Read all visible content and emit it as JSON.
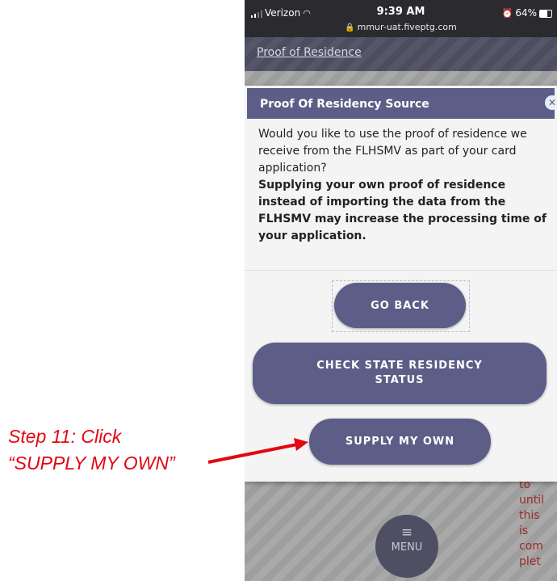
{
  "status_bar": {
    "carrier": "Verizon",
    "time": "9:39 AM",
    "battery": "64%",
    "url": "mmur-uat.fiveptg.com"
  },
  "page": {
    "title": "Proof of Residence"
  },
  "dialog": {
    "title": "Proof Of Residency Source",
    "question": "Would you like to use the proof of residence we receive from the FLHSMV as part of your card application?",
    "warning": "Supplying your own proof of residence instead of importing the data from the FLHSMV may increase the processing time of your application.",
    "buttons": {
      "go_back": "GO BACK",
      "check_state_line1": "CHECK STATE RESIDENCY",
      "check_state_line2": "STATUS",
      "supply_own": "SUPPLY MY OWN"
    }
  },
  "background_text": [
    "to",
    "until",
    "this",
    "is",
    "com",
    "plet"
  ],
  "menu": {
    "label": "MENU"
  },
  "annotation": {
    "line1": "Step 11: Click",
    "line2": "“SUPPLY MY OWN”",
    "color": "#e30613"
  },
  "colors": {
    "accent": "#5d5e87",
    "statusbar": "#2b2b2f"
  }
}
